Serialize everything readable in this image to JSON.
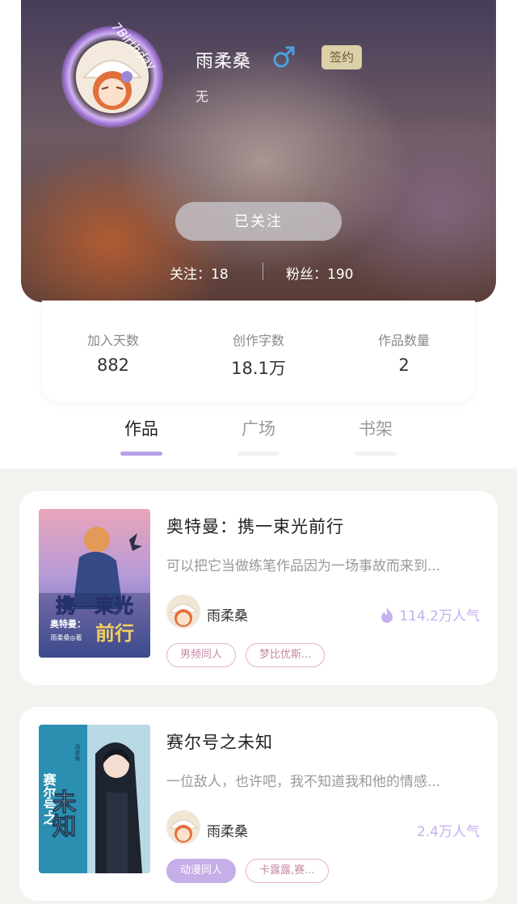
{
  "profile": {
    "username": "雨柔桑",
    "gender_icon": "male-symbol-icon",
    "sign_badge": "签约",
    "bio": "无",
    "avatar_frame_text": "7Birthday",
    "follow_button": "已关注",
    "following": "关注：18",
    "followers": "粉丝：190"
  },
  "stats": [
    {
      "label": "加入天数",
      "value": "882"
    },
    {
      "label": "创作字数",
      "value": "18.1万"
    },
    {
      "label": "作品数量",
      "value": "2"
    }
  ],
  "tabs": [
    {
      "label": "作品",
      "active": true
    },
    {
      "label": "广场",
      "active": false
    },
    {
      "label": "书架",
      "active": false
    }
  ],
  "books": [
    {
      "title": "奥特曼：携一束光前行",
      "description": "可以把它当做练笔作品因为一场事故而来到...",
      "author": "雨柔桑",
      "popularity": "114.2万人气",
      "hot_icon": "flame-icon",
      "tags": [
        "男频同人",
        "梦比优斯..."
      ],
      "cover_text": {
        "main": "携一束光",
        "sub1": "奥特曼：",
        "sub2": "前行",
        "small": "雨柔桑◎著"
      }
    },
    {
      "title": "赛尔号之未知",
      "description": "一位敌人，也许吧，我不知道我和他的情感...",
      "author": "雨柔桑",
      "popularity": "2.4万人气",
      "tags": [
        "动漫同人",
        "卡露露,赛..."
      ],
      "cover_text": {
        "main": "未知",
        "side": "赛尔号之",
        "small": "雨柔桑"
      }
    }
  ],
  "colors": {
    "accent": "#b8a0e8",
    "badge": "#dcd0a8",
    "gender": "#4aa3e0"
  }
}
